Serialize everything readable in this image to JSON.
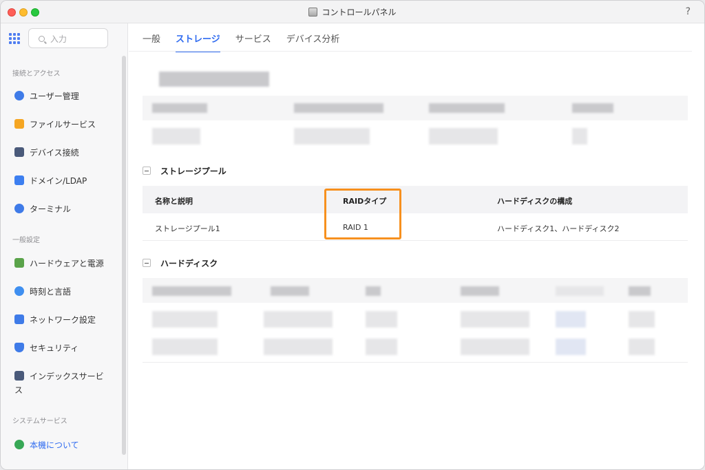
{
  "window": {
    "title": "コントロールパネル",
    "help": "?"
  },
  "sidebar": {
    "search_placeholder": "入力",
    "sections": [
      {
        "label": "接続とアクセス"
      },
      {
        "label": "一般設定"
      },
      {
        "label": "システムサービス"
      }
    ],
    "items": [
      {
        "label": "ユーザー管理",
        "icon": "user-icon",
        "color": "#3f7be8"
      },
      {
        "label": "ファイルサービス",
        "icon": "folder-icon",
        "color": "#f5a623"
      },
      {
        "label": "デバイス接続",
        "icon": "device-icon",
        "color": "#4a5a7a"
      },
      {
        "label": "ドメイン/LDAP",
        "icon": "domain-icon",
        "color": "#3d7ff0"
      },
      {
        "label": "ターミナル",
        "icon": "terminal-icon",
        "color": "#3f7be8"
      },
      {
        "label": "ハードウェアと電源",
        "icon": "battery-icon",
        "color": "#5aa34a"
      },
      {
        "label": "時刻と言語",
        "icon": "globe-icon",
        "color": "#3f8ff0"
      },
      {
        "label": "ネットワーク設定",
        "icon": "network-icon",
        "color": "#3f7be8"
      },
      {
        "label": "セキュリティ",
        "icon": "shield-icon",
        "color": "#3f7be8"
      },
      {
        "label": "インデックスサービス",
        "icon": "index-icon",
        "color": "#4a5a7a"
      },
      {
        "label": "本機について",
        "icon": "info-icon",
        "color": "#38a856"
      }
    ]
  },
  "tabs": [
    {
      "label": "一般"
    },
    {
      "label": "ストレージ"
    },
    {
      "label": "サービス"
    },
    {
      "label": "デバイス分析"
    }
  ],
  "storage_pool": {
    "title": "ストレージプール",
    "columns": [
      "名称と説明",
      "RAIDタイプ",
      "ハードディスクの構成"
    ],
    "rows": [
      {
        "name": "ストレージプール1",
        "raid": "RAID 1",
        "disks": "ハードディスク1、ハードディスク2"
      }
    ]
  },
  "hard_disk": {
    "title": "ハードディスク"
  },
  "colors": {
    "accent": "#2f6bf0",
    "highlight": "#f7901e"
  }
}
